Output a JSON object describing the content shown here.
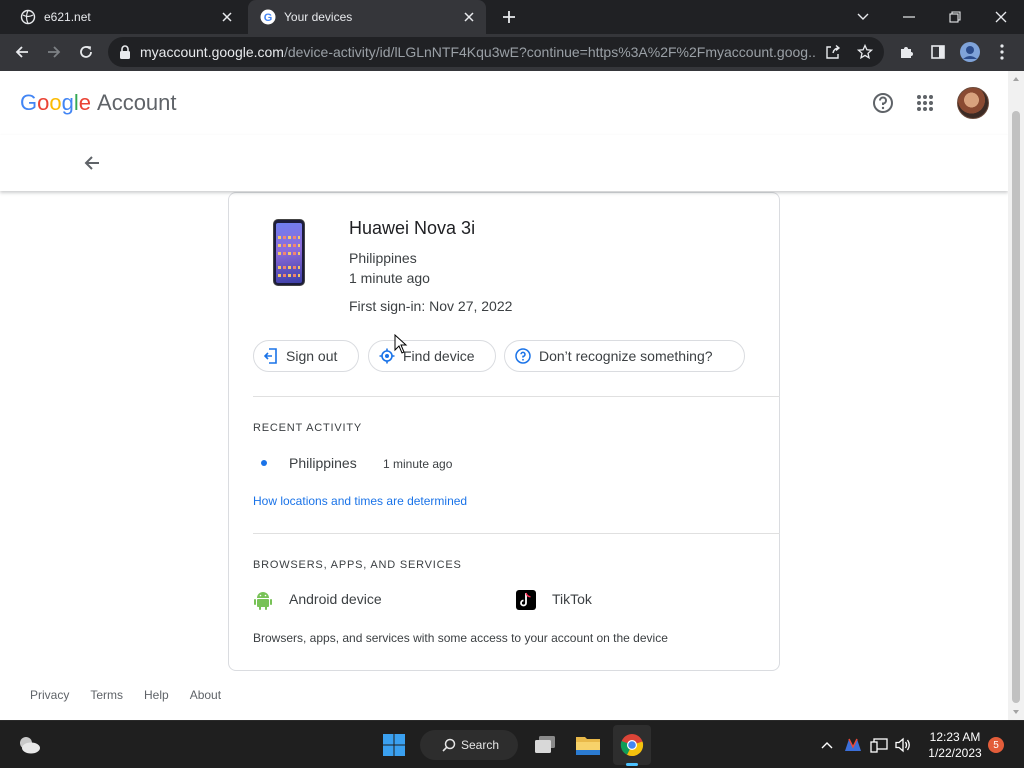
{
  "browser": {
    "tabs": [
      {
        "title": "e621.net",
        "active": false
      },
      {
        "title": "Your devices",
        "active": true
      }
    ],
    "url_host": "myaccount.google.com",
    "url_path": "/device-activity/id/lLGLnNTF4Kqu3wE?continue=https%3A%2F%2Fmyaccount.goog..."
  },
  "header": {
    "logo_letters": [
      "G",
      "o",
      "o",
      "g",
      "l",
      "e"
    ],
    "logo_suffix": "Account"
  },
  "device": {
    "name": "Huawei Nova 3i",
    "location": "Philippines",
    "last_seen": "1 minute ago",
    "first_signin": "First sign-in: Nov 27, 2022"
  },
  "actions": {
    "sign_out": "Sign out",
    "find_device": "Find device",
    "dont_recognize": "Don’t recognize something?"
  },
  "recent_activity": {
    "heading": "RECENT ACTIVITY",
    "items": [
      {
        "place": "Philippines",
        "time": "1 minute ago"
      }
    ],
    "link": "How locations and times are determined"
  },
  "services": {
    "heading": "BROWSERS, APPS, AND SERVICES",
    "items": [
      {
        "name": "Android device",
        "icon": "android-icon"
      },
      {
        "name": "TikTok",
        "icon": "tiktok-icon"
      }
    ],
    "note": "Browsers, apps, and services with some access to your account on the device"
  },
  "footer": {
    "links": [
      "Privacy",
      "Terms",
      "Help",
      "About"
    ]
  },
  "taskbar": {
    "search_label": "Search",
    "time": "12:23 AM",
    "date": "1/22/2023",
    "notification_count": "5"
  },
  "colors": {
    "link_blue": "#1a73e8",
    "android_green": "#78c257",
    "chrome_dark": "#202124"
  }
}
